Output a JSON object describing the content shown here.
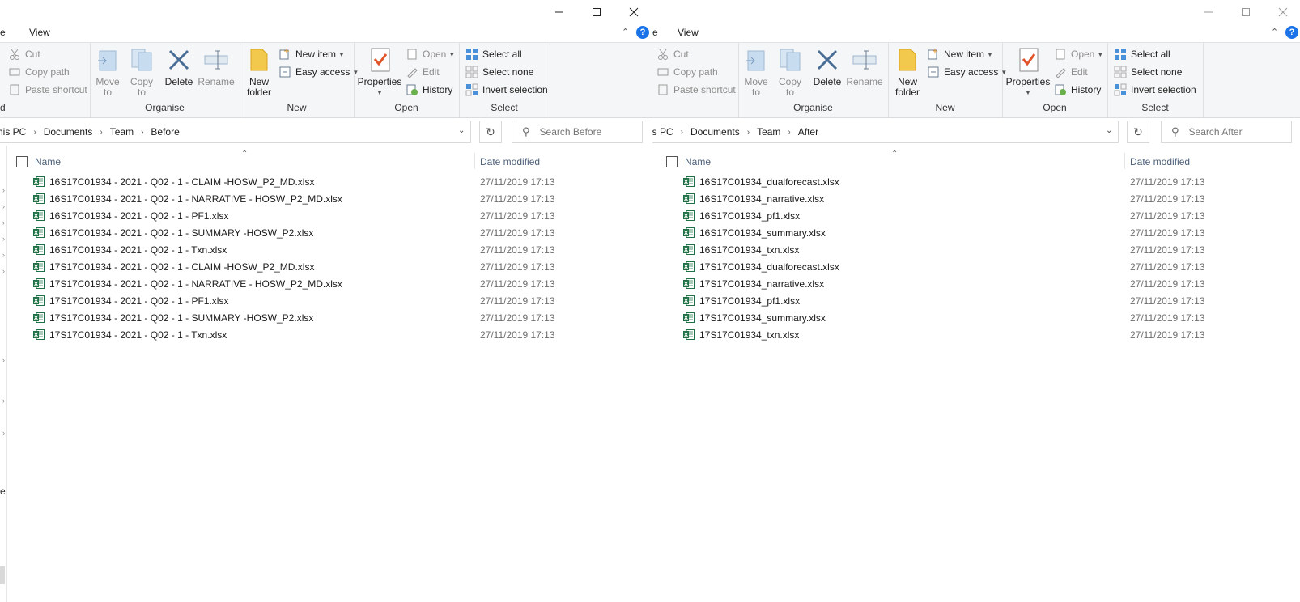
{
  "left": {
    "ribbon_tabs": {
      "partial": "e",
      "view": "View"
    },
    "clipboard": {
      "cut": "Cut",
      "copy_path": "Copy path",
      "paste_shortcut": "Paste shortcut",
      "partial_label": "d"
    },
    "organise": {
      "move_to": "Move to",
      "copy_to": "Copy to",
      "delete": "Delete",
      "rename": "Rename",
      "label": "Organise"
    },
    "new": {
      "new_folder": "New folder",
      "new_item": "New item",
      "easy_access": "Easy access",
      "label": "New"
    },
    "open": {
      "properties": "Properties",
      "open": "Open",
      "edit": "Edit",
      "history": "History",
      "label": "Open"
    },
    "select": {
      "select_all": "Select all",
      "select_none": "Select none",
      "invert_selection": "Invert selection",
      "label": "Select"
    },
    "breadcrumb": [
      "his PC",
      "Documents",
      "Team",
      "Before"
    ],
    "search_placeholder": "Search Before",
    "columns": {
      "name": "Name",
      "date": "Date modified"
    },
    "nav_fragment": "e",
    "files": [
      {
        "name": "16S17C01934 - 2021 - Q02 - 1 - CLAIM -HOSW_P2_MD.xlsx",
        "date": "27/11/2019 17:13"
      },
      {
        "name": "16S17C01934 - 2021 - Q02 - 1 - NARRATIVE - HOSW_P2_MD.xlsx",
        "date": "27/11/2019 17:13"
      },
      {
        "name": "16S17C01934 - 2021 - Q02 - 1 - PF1.xlsx",
        "date": "27/11/2019 17:13"
      },
      {
        "name": "16S17C01934 - 2021 - Q02 - 1 - SUMMARY -HOSW_P2.xlsx",
        "date": "27/11/2019 17:13"
      },
      {
        "name": "16S17C01934 - 2021 - Q02 - 1 - Txn.xlsx",
        "date": "27/11/2019 17:13"
      },
      {
        "name": "17S17C01934 - 2021 - Q02 - 1 - CLAIM -HOSW_P2_MD.xlsx",
        "date": "27/11/2019 17:13"
      },
      {
        "name": "17S17C01934 - 2021 - Q02 - 1 - NARRATIVE - HOSW_P2_MD.xlsx",
        "date": "27/11/2019 17:13"
      },
      {
        "name": "17S17C01934 - 2021 - Q02 - 1 - PF1.xlsx",
        "date": "27/11/2019 17:13"
      },
      {
        "name": "17S17C01934 - 2021 - Q02 - 1 - SUMMARY -HOSW_P2.xlsx",
        "date": "27/11/2019 17:13"
      },
      {
        "name": "17S17C01934 - 2021 - Q02 - 1 - Txn.xlsx",
        "date": "27/11/2019 17:13"
      }
    ]
  },
  "right": {
    "ribbon_tabs": {
      "partial": "e",
      "view": "View"
    },
    "clipboard": {
      "cut": "Cut",
      "copy_path": "Copy path",
      "paste_shortcut": "Paste shortcut"
    },
    "organise": {
      "move_to": "Move to",
      "copy_to": "Copy to",
      "delete": "Delete",
      "rename": "Rename",
      "label": "Organise"
    },
    "new": {
      "new_folder": "New folder",
      "new_item": "New item",
      "easy_access": "Easy access",
      "label": "New"
    },
    "open": {
      "properties": "Properties",
      "open": "Open",
      "edit": "Edit",
      "history": "History",
      "label": "Open"
    },
    "select": {
      "select_all": "Select all",
      "select_none": "Select none",
      "invert_selection": "Invert selection",
      "label": "Select"
    },
    "breadcrumb": [
      "is PC",
      "Documents",
      "Team",
      "After"
    ],
    "search_placeholder": "Search After",
    "columns": {
      "name": "Name",
      "date": "Date modified"
    },
    "files": [
      {
        "name": "16S17C01934_dualforecast.xlsx",
        "date": "27/11/2019 17:13"
      },
      {
        "name": "16S17C01934_narrative.xlsx",
        "date": "27/11/2019 17:13"
      },
      {
        "name": "16S17C01934_pf1.xlsx",
        "date": "27/11/2019 17:13"
      },
      {
        "name": "16S17C01934_summary.xlsx",
        "date": "27/11/2019 17:13"
      },
      {
        "name": "16S17C01934_txn.xlsx",
        "date": "27/11/2019 17:13"
      },
      {
        "name": "17S17C01934_dualforecast.xlsx",
        "date": "27/11/2019 17:13"
      },
      {
        "name": "17S17C01934_narrative.xlsx",
        "date": "27/11/2019 17:13"
      },
      {
        "name": "17S17C01934_pf1.xlsx",
        "date": "27/11/2019 17:13"
      },
      {
        "name": "17S17C01934_summary.xlsx",
        "date": "27/11/2019 17:13"
      },
      {
        "name": "17S17C01934_txn.xlsx",
        "date": "27/11/2019 17:13"
      }
    ]
  },
  "icons": {
    "minimize": "minimize-icon",
    "maximize": "maximize-icon",
    "close": "close-icon",
    "excel": "excel-file-icon",
    "help": "help-icon",
    "search": "search-icon",
    "refresh": "refresh-icon"
  },
  "colors": {
    "accent": "#1a73e8",
    "excel_green": "#1e7145",
    "ribbon_bg": "#f5f6f7",
    "header_text": "#4c607a"
  }
}
